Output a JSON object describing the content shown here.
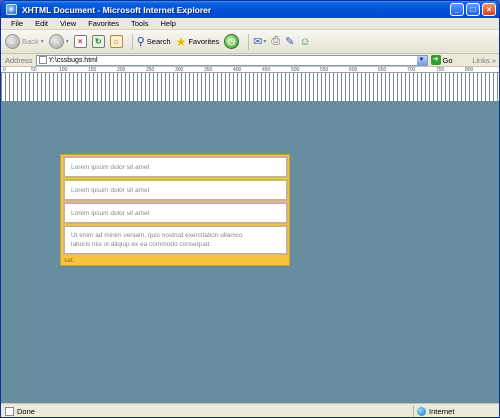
{
  "window": {
    "title": "XHTML Document - Microsoft Internet Explorer",
    "controls": {
      "minimize": "_",
      "maximize": "□",
      "close": "×"
    }
  },
  "menu": [
    "File",
    "Edit",
    "View",
    "Favorites",
    "Tools",
    "Help"
  ],
  "toolbar": {
    "back_label": "Back",
    "search_label": "Search",
    "favorites_label": "Favorites"
  },
  "address": {
    "label": "Address",
    "url": "Y:\\cssbugs.html",
    "go_label": "Go",
    "links_label": "Links"
  },
  "ruler": {
    "ticks": [
      "0",
      "50",
      "100",
      "150",
      "200",
      "250",
      "300",
      "350",
      "400",
      "450",
      "500",
      "550",
      "600",
      "650",
      "700",
      "750",
      "800"
    ]
  },
  "content": {
    "items": [
      "Lorem ipsum dolor sit amet",
      "Lorem ipsum dolor sit amet",
      "Lorem ipsum dolor sit amet"
    ],
    "paragraph_line1": "Ut enim ad minim veniam, quis nostrud exercitation ullamco",
    "paragraph_line2": "laboris nisi ut aliquip ex ea commodo consequat.",
    "trailing_word": "vat."
  },
  "status": {
    "text": "Done",
    "zone": "Internet"
  },
  "colors": {
    "page_bg": "#668ea0",
    "panel": "#f7c440",
    "item_border": "#c9b48a",
    "titlebar": "#0050d8"
  },
  "icons": [
    "back-icon",
    "forward-icon",
    "stop-icon",
    "refresh-icon",
    "home-icon",
    "search-icon",
    "favorites-star-icon",
    "history-icon",
    "mail-icon",
    "print-icon",
    "edit-icon",
    "messenger-icon",
    "page-icon",
    "go-arrow-icon",
    "globe-icon"
  ]
}
